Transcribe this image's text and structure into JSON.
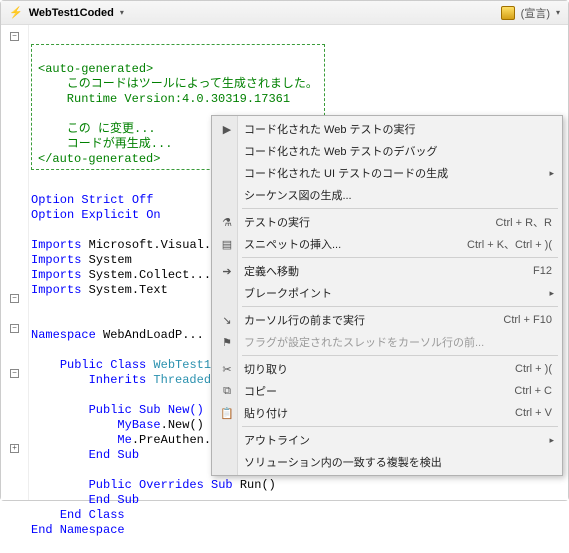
{
  "header": {
    "title": "WebTest1Coded",
    "declaration": "(宣言)"
  },
  "code": {
    "autogen_open": "<auto-generated>",
    "autogen_line1": "    このコードはツールによって生成されました。",
    "autogen_line2": "    Runtime Version:4.0.30319.17361",
    "autogen_blank": "",
    "autogen_line3": "    この に変更...",
    "autogen_line4": "    コードが再生成...",
    "autogen_close": "</auto-generated>",
    "option_strict": "Option Strict Off",
    "option_explicit": "Option Explicit On",
    "imports_kw": "Imports",
    "imports_1": " Microsoft.Visual...",
    "imports_2": " System",
    "imports_3": " System.Collect...",
    "imports_4": " System.Text",
    "namespace_kw": "Namespace",
    "namespace_name": " WebAndLoadP...",
    "class_kw": "Public Class",
    "class_name": " WebTest1...",
    "inherits_kw": "Inherits",
    "inherits_name": " Threaded...",
    "sub_new": "Public Sub New()",
    "mybase": "MyBase",
    "new_call": ".New()",
    "me_kw": "Me",
    "preauth": ".PreAuthen...",
    "end_sub": "End Sub",
    "overrides": "Public Overrides Sub",
    "run": " Run()",
    "end_sub2": "End Sub",
    "end_class": "End Class",
    "end_namespace": "End Namespace"
  },
  "menu": {
    "items": [
      {
        "label": "コード化された Web テストの実行",
        "icon": "run-icon"
      },
      {
        "label": "コード化された Web テストのデバッグ"
      },
      {
        "label": "コード化された UI テストのコードの生成",
        "submenu": true
      },
      {
        "label": "シーケンス図の生成..."
      },
      {
        "sep": true
      },
      {
        "label": "テストの実行",
        "shortcut": "Ctrl + R、R",
        "icon": "flask-icon"
      },
      {
        "label": "スニペットの挿入...",
        "shortcut": "Ctrl + K、Ctrl + )(",
        "icon": "snippet-icon"
      },
      {
        "sep": true
      },
      {
        "label": "定義へ移動",
        "shortcut": "F12",
        "icon": "goto-icon"
      },
      {
        "label": "ブレークポイント",
        "submenu": true
      },
      {
        "sep": true
      },
      {
        "label": "カーソル行の前まで実行",
        "shortcut": "Ctrl + F10",
        "icon": "run-to-icon"
      },
      {
        "label": "フラグが設定されたスレッドをカーソル行の前...",
        "disabled": true,
        "icon": "flag-icon"
      },
      {
        "sep": true
      },
      {
        "label": "切り取り",
        "shortcut": "Ctrl + )(",
        "icon": "cut-icon"
      },
      {
        "label": "コピー",
        "shortcut": "Ctrl + C",
        "icon": "copy-icon"
      },
      {
        "label": "貼り付け",
        "shortcut": "Ctrl + V",
        "icon": "paste-icon"
      },
      {
        "sep": true
      },
      {
        "label": "アウトライン",
        "submenu": true
      },
      {
        "label": "ソリューション内の一致する複製を検出"
      }
    ]
  }
}
